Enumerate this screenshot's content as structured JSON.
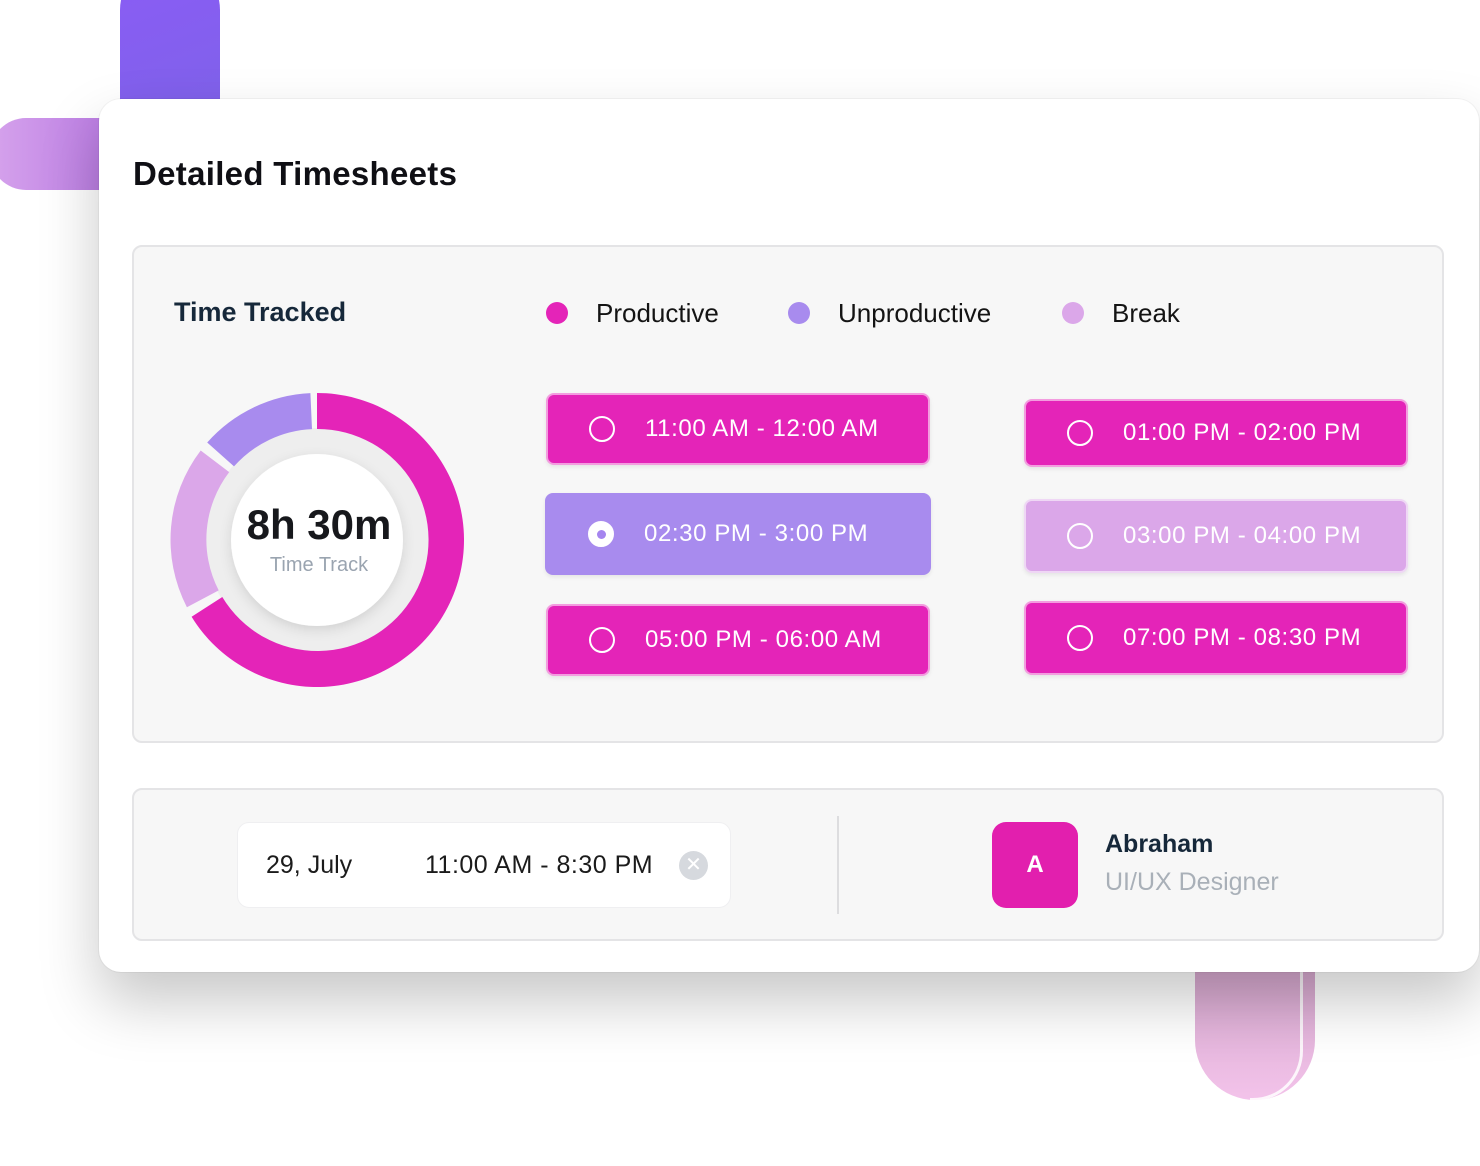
{
  "colors": {
    "productive": "#e424b8",
    "unproductive": "#a88bee",
    "break": "#dba7e9",
    "accent": "#e21fae"
  },
  "card": {
    "title": "Detailed Timesheets"
  },
  "time_tracked": {
    "heading": "Time Tracked",
    "legend": [
      {
        "label": "Productive",
        "color": "#e424b8"
      },
      {
        "label": "Unproductive",
        "color": "#a88bee"
      },
      {
        "label": "Break",
        "color": "#dba7e9"
      }
    ],
    "donut": {
      "value": "8h 30m",
      "caption": "Time Track"
    }
  },
  "slots": [
    {
      "label": "11:00 AM - 12:00 AM",
      "type": "productive",
      "selected": false
    },
    {
      "label": "02:30 PM - 3:00 PM",
      "type": "unproductive",
      "selected": true
    },
    {
      "label": "05:00 PM - 06:00 AM",
      "type": "productive",
      "selected": false
    },
    {
      "label": "01:00 PM - 02:00 PM",
      "type": "productive",
      "selected": false
    },
    {
      "label": "03:00 PM - 04:00 PM",
      "type": "break",
      "selected": false
    },
    {
      "label": "07:00 PM - 08:30 PM",
      "type": "productive",
      "selected": false
    }
  ],
  "filter": {
    "date": "29, July",
    "range": "11:00 AM - 8:30 PM",
    "clear_icon": "close-icon"
  },
  "user": {
    "initial": "A",
    "name": "Abraham",
    "role": "UI/UX Designer"
  }
}
